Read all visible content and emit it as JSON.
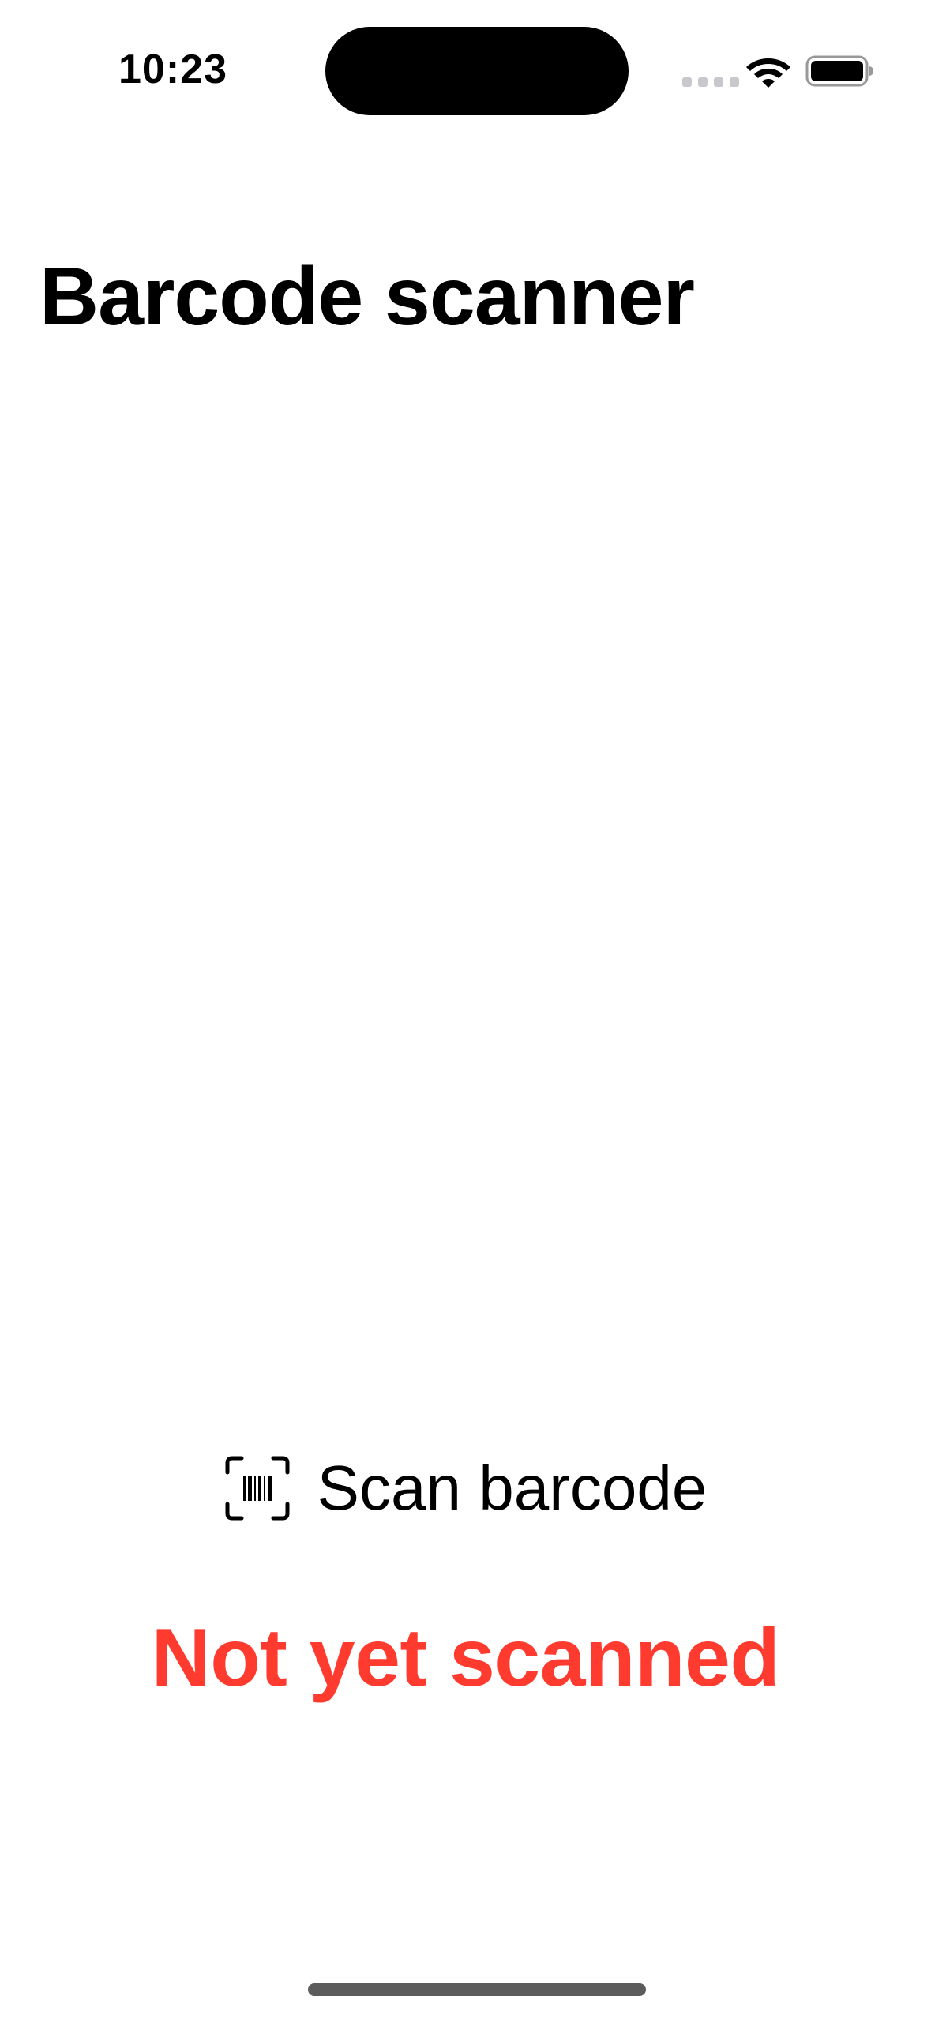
{
  "status_bar": {
    "time": "10:23",
    "icons": [
      "signal-dots-icon",
      "wifi-icon",
      "battery-icon"
    ]
  },
  "header": {
    "title": "Barcode scanner"
  },
  "scan_button": {
    "label": "Scan barcode",
    "icon": "barcode-viewfinder-icon"
  },
  "scan_status": {
    "text": "Not yet scanned",
    "color": "#ff3b30"
  }
}
